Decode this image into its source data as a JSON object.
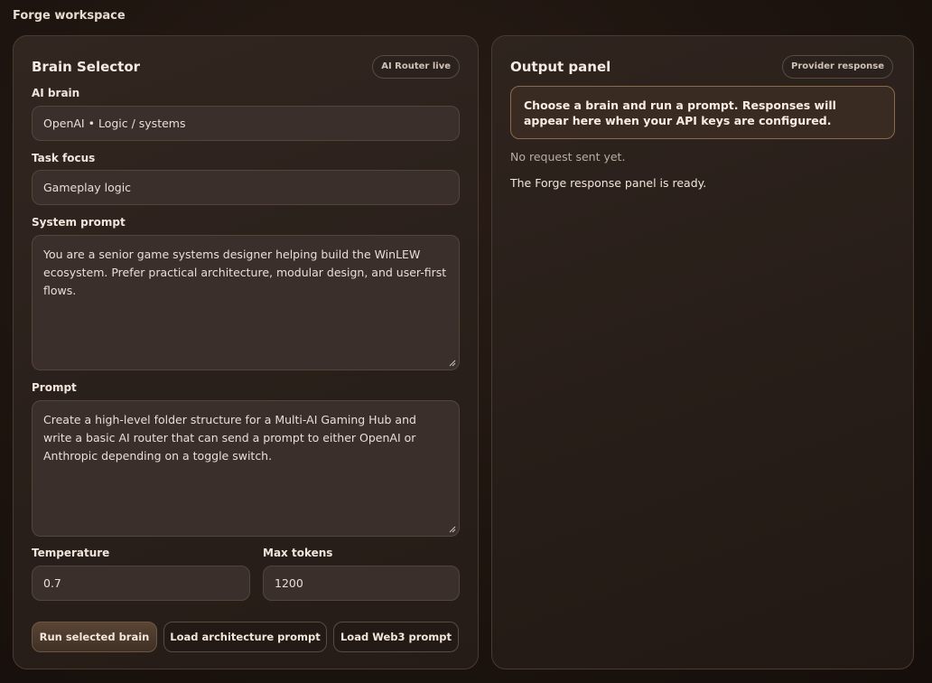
{
  "workspace": {
    "title": "Forge workspace"
  },
  "brain_selector": {
    "title": "Brain Selector",
    "badge": "AI Router live",
    "ai_brain": {
      "label": "AI brain",
      "value": "OpenAI • Logic / systems"
    },
    "task_focus": {
      "label": "Task focus",
      "value": "Gameplay logic"
    },
    "system_prompt": {
      "label": "System prompt",
      "value": "You are a senior game systems designer helping build the WinLEW ecosystem. Prefer practical architecture, modular design, and user-first flows."
    },
    "prompt": {
      "label": "Prompt",
      "value": "Create a high-level folder structure for a Multi-AI Gaming Hub and write a basic AI router that can send a prompt to either OpenAI or Anthropic depending on a toggle switch."
    },
    "temperature": {
      "label": "Temperature",
      "value": "0.7"
    },
    "max_tokens": {
      "label": "Max tokens",
      "value": "1200"
    },
    "buttons": {
      "run": "Run selected brain",
      "load_architecture": "Load architecture prompt",
      "load_web3": "Load Web3 prompt"
    }
  },
  "output_panel": {
    "title": "Output panel",
    "badge": "Provider response",
    "callout": "Choose a brain and run a prompt. Responses will appear here when your API keys are configured.",
    "status_line": "No request sent yet.",
    "ready_line": "The Forge response panel is ready."
  },
  "colors": {
    "background": "#1a110d",
    "card": "#2c221d",
    "field": "#3a2f2a",
    "callout_border": "#8a6a4f",
    "primary_button": "#4d3b2e"
  }
}
